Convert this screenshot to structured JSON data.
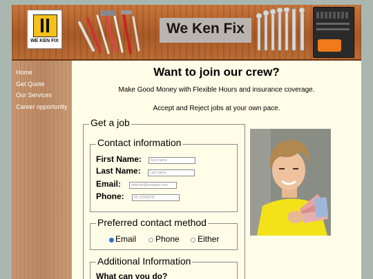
{
  "header": {
    "logo_text": "WE KEN FIX",
    "brand": "We Ken Fix"
  },
  "sidebar": {
    "items": [
      {
        "label": "Home"
      },
      {
        "label": "Get Quote"
      },
      {
        "label": "Our Services"
      },
      {
        "label": "Career opportunity"
      }
    ]
  },
  "main": {
    "title": "Want to join our crew?",
    "line1": "Make Good Money with Flexible Hours and insurance coverage.",
    "line2": "Accept and Reject jobs at your own pace."
  },
  "form": {
    "legend": "Get a job",
    "contact": {
      "legend": "Contact information",
      "first_name_label": "First Name:",
      "first_name_placeholder": "First name",
      "last_name_label": "Last Name:",
      "last_name_placeholder": "Last name",
      "email_label": "Email:",
      "email_placeholder": "address@example.com",
      "phone_label": "Phone:",
      "phone_placeholder": "65 12345678"
    },
    "preferred": {
      "legend": "Preferred contact method",
      "options": [
        "Email",
        "Phone",
        "Either"
      ],
      "selected": "Email"
    },
    "additional": {
      "legend": "Additional Information",
      "question": "What can you do?"
    }
  },
  "colors": {
    "page_bg": "#fffde8",
    "outer_bg": "#a9b7b0",
    "radio_selected": "#2d6fd8"
  }
}
